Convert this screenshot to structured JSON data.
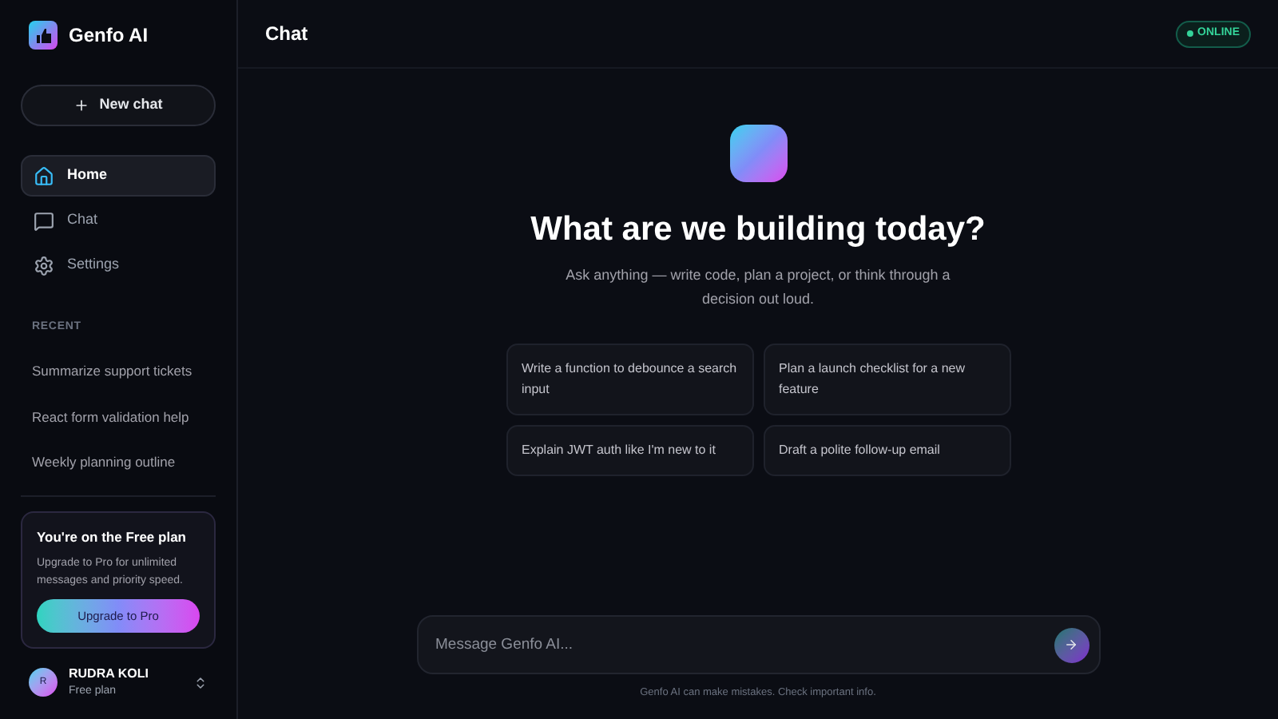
{
  "sidebar": {
    "brand": "Genfo AI",
    "new_chat": "New chat",
    "nav": [
      {
        "kind": "home",
        "label": "Home",
        "selected": true
      },
      {
        "kind": "chat",
        "label": "Chat",
        "selected": false
      },
      {
        "kind": "settings",
        "label": "Settings",
        "selected": false
      }
    ],
    "recent_heading": "RECENT",
    "recent": [
      "Summarize support tickets",
      "React form validation help",
      "Weekly planning outline"
    ],
    "plan_card": {
      "title": "You're on the Free plan",
      "text": "Upgrade to Pro for unlimited messages and priority speed.",
      "button": "Upgrade to Pro"
    },
    "user": {
      "initial": "R",
      "name": "RUDRA KOLI",
      "plan": "Free plan"
    }
  },
  "header": {
    "title": "Chat",
    "status": "ONLINE"
  },
  "hero": {
    "title": "What are we building today?",
    "subtitle": "Ask anything — write code, plan a project, or think through a decision out loud."
  },
  "suggestions": [
    "Write a function to debounce a search input",
    "Plan a launch checklist for a new feature",
    "Explain JWT auth like I'm new to it",
    "Draft a polite follow-up email"
  ],
  "composer": {
    "placeholder": "Message Genfo AI...",
    "disclaimer": "Genfo AI can make mistakes. Check important info."
  }
}
